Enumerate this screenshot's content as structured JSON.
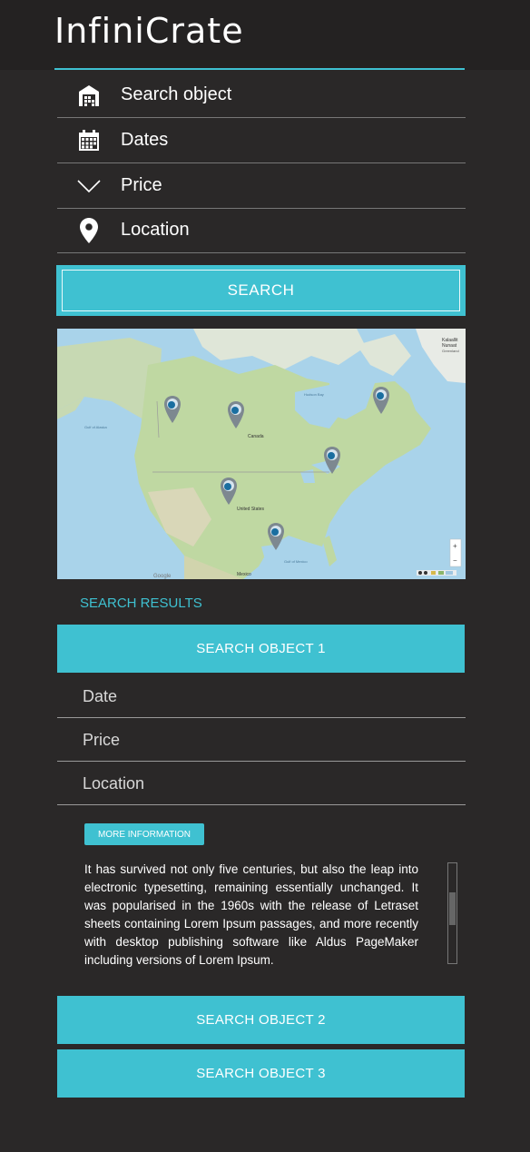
{
  "app": {
    "title": "InfiniCrate"
  },
  "filters": [
    {
      "icon": "warehouse-icon",
      "label": "Search object"
    },
    {
      "icon": "calendar-icon",
      "label": "Dates"
    },
    {
      "icon": "chevron-down-icon",
      "label": "Price"
    },
    {
      "icon": "location-pin-icon",
      "label": "Location"
    }
  ],
  "search_button": {
    "label": "SEARCH"
  },
  "map": {
    "labels": {
      "satellite_top": "Kalaallit",
      "satellite_mid": "Nunaat",
      "satellite_bottom": "Greenland",
      "gulf_alaska": "Gulf of Alaska",
      "hudson_bay": "Hudson Bay",
      "canada": "Canada",
      "united_states": "United States",
      "mexico": "Mexico",
      "gulf_mexico": "Gulf of Mexico",
      "google": "Google"
    },
    "zoom_controls": {
      "plus": "+",
      "minus": "−"
    }
  },
  "results": {
    "title": "SEARCH RESULTS",
    "items": [
      {
        "title": "SEARCH OBJECT 1",
        "date_label": "Date",
        "price_label": "Price",
        "location_label": "Location",
        "more_label": "MORE INFORMATION",
        "description": "It has survived not only five centuries, but also the leap into electronic typesetting, remaining essentially unchanged. It was popularised in the 1960s with the release of Letraset sheets containing Lorem Ipsum passages, and more recently with desktop publishing software like Aldus PageMaker including versions of Lorem Ipsum."
      },
      {
        "title": "SEARCH OBJECT 2"
      },
      {
        "title": "SEARCH OBJECT 3"
      }
    ]
  },
  "colors": {
    "background": "#2a2828",
    "accent": "#3fc1d1",
    "header": "#242222"
  }
}
